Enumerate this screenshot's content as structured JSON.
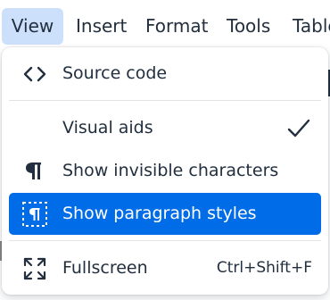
{
  "menubar": {
    "items": [
      {
        "label": "View",
        "active": true
      },
      {
        "label": "Insert"
      },
      {
        "label": "Format"
      },
      {
        "label": "Tools"
      },
      {
        "label": "Table"
      }
    ]
  },
  "dropdown": {
    "items": [
      {
        "label": "Source code",
        "icon": "source-code-icon"
      },
      {
        "label": "Visual aids",
        "checked": true,
        "icon": "checkmark-icon"
      },
      {
        "label": "Show invisible characters",
        "icon": "pilcrow-icon"
      },
      {
        "label": "Show paragraph styles",
        "icon": "paragraph-styles-icon",
        "highlighted": true
      },
      {
        "label": "Fullscreen",
        "shortcut": "Ctrl+Shift+F",
        "icon": "fullscreen-icon"
      }
    ]
  },
  "colors": {
    "text": "#222f3e",
    "highlight": "#006ce7",
    "active_menubar": "#cde0fb"
  }
}
